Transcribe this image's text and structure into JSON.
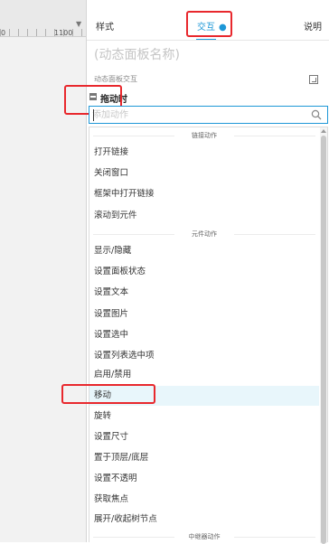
{
  "ruler": {
    "tick_left": "0",
    "tick_right": "1100"
  },
  "tabs": {
    "style": "样式",
    "interaction": "交互",
    "interaction_dot": "●",
    "notes": "说明"
  },
  "panel": {
    "name_placeholder": "(动态面板名称)",
    "section_label": "动态面板交互",
    "event_label": "拖动时",
    "search_placeholder": "添加动作"
  },
  "groups": {
    "link": "链接动作",
    "widget": "元件动作",
    "repeater": "中继器动作"
  },
  "items": {
    "open_link": "打开链接",
    "close_window": "关闭窗口",
    "open_in_frame": "框架中打开链接",
    "scroll_to": "滚动到元件",
    "show_hide": "显示/隐藏",
    "set_panel_state": "设置面板状态",
    "set_text": "设置文本",
    "set_image": "设置图片",
    "set_selected": "设置选中",
    "set_list_selected": "设置列表选中项",
    "enable_disable": "启用/禁用",
    "move": "移动",
    "rotate": "旋转",
    "set_size": "设置尺寸",
    "bring_front_back": "置于顶层/底层",
    "set_opacity": "设置不透明",
    "focus": "获取焦点",
    "expand_collapse": "展开/收起树节点"
  },
  "colors": {
    "accent": "#1d97d7",
    "highlight_box": "#e8282d",
    "active_row": "#e8f6fb"
  },
  "state": {
    "active_tab": "interaction",
    "hovered_item": "move"
  }
}
